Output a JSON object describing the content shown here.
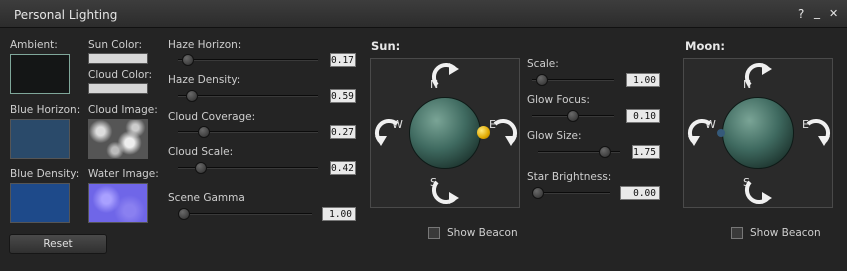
{
  "window": {
    "title": "Personal Lighting",
    "help_label": "?",
    "minimize_label": "_",
    "close_label": "✕"
  },
  "colors": {
    "ambient_label": "Ambient:",
    "blue_horizon_label": "Blue Horizon:",
    "blue_density_label": "Blue Density:",
    "sun_color_label": "Sun Color:",
    "cloud_color_label": "Cloud Color:",
    "cloud_image_label": "Cloud Image:",
    "water_image_label": "Water Image:",
    "ambient_hex": "#141616",
    "blue_horizon_hex": "#2a4a6a",
    "blue_density_hex": "#1e4a8a",
    "sun_color_hex": "#d8d8d8",
    "cloud_color_hex": "#d6d6d6",
    "reset_label": "Reset"
  },
  "sky_sliders": [
    {
      "label": "Haze Horizon:",
      "value": "0.17",
      "fraction": 0.03
    },
    {
      "label": "Haze Density:",
      "value": "0.59",
      "fraction": 0.06
    },
    {
      "label": "Cloud Coverage:",
      "value": "0.27",
      "fraction": 0.16
    },
    {
      "label": "Cloud Scale:",
      "value": "0.42",
      "fraction": 0.13
    },
    {
      "label": "Scene Gamma",
      "value": "1.00",
      "fraction": 0.0
    }
  ],
  "sun": {
    "title": "Sun:",
    "north": "N",
    "south": "S",
    "west": "W",
    "east": "E",
    "beacon_label": "Show Beacon"
  },
  "sun_sliders": [
    {
      "label": "Scale:",
      "value": "1.00",
      "fraction": 0.05
    },
    {
      "label": "Glow Focus:",
      "value": "0.10",
      "fraction": 0.5
    },
    {
      "label": "Glow Size:",
      "value": "1.75",
      "fraction": 0.87
    },
    {
      "label": "Star Brightness:",
      "value": "0.00",
      "fraction": 0.0
    }
  ],
  "moon": {
    "title": "Moon:",
    "north": "N",
    "south": "S",
    "west": "W",
    "east": "E",
    "beacon_label": "Show Beacon"
  }
}
